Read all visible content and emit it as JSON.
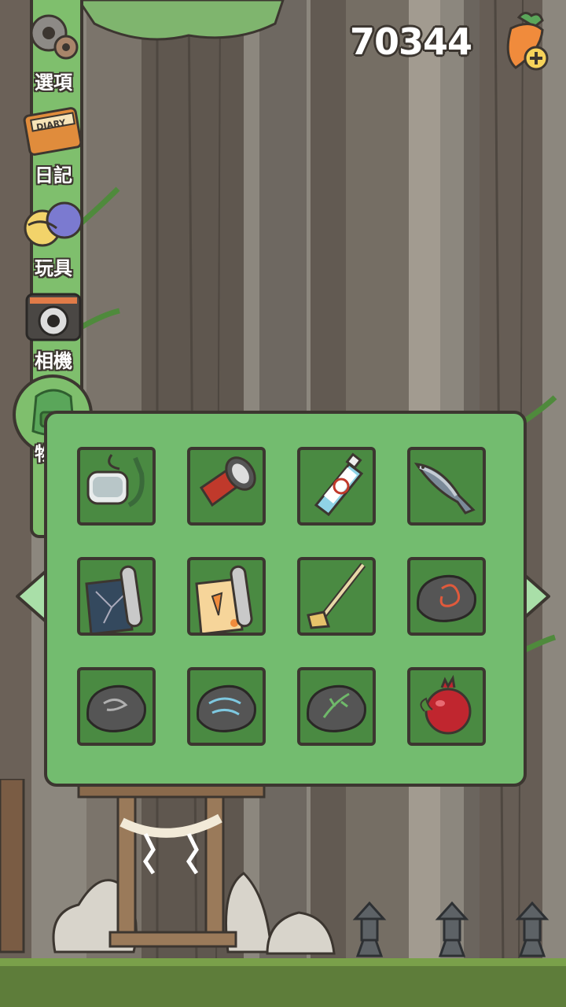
{
  "currency": {
    "amount": "70344",
    "icon": "carrot-plus-icon"
  },
  "menu": {
    "items": [
      {
        "label": "選項",
        "icon": "gear-icon"
      },
      {
        "label": "日記",
        "icon": "diary-icon",
        "book_text": "DIARY"
      },
      {
        "label": "玩具",
        "icon": "toy-balls-icon"
      },
      {
        "label": "相機",
        "icon": "camera-icon"
      },
      {
        "label": "物品",
        "icon": "backpack-icon",
        "active": true
      }
    ]
  },
  "inventory": {
    "items": [
      {
        "icon": "snorkel-mask-icon"
      },
      {
        "icon": "flashlight-icon"
      },
      {
        "icon": "bug-spray-icon"
      },
      {
        "icon": "fish-icon"
      },
      {
        "icon": "dark-map-scroll-icon"
      },
      {
        "icon": "carrot-map-scroll-icon"
      },
      {
        "icon": "hoe-icon"
      },
      {
        "icon": "fire-stone-icon"
      },
      {
        "icon": "cloud-stone-icon"
      },
      {
        "icon": "wind-stone-icon"
      },
      {
        "icon": "leaf-stone-icon"
      },
      {
        "icon": "pomegranate-icon"
      }
    ]
  },
  "colors": {
    "panel": "#73bc6f",
    "slot": "#4a8a42",
    "outline": "#3c3630",
    "arrow": "#a9dfa8"
  }
}
